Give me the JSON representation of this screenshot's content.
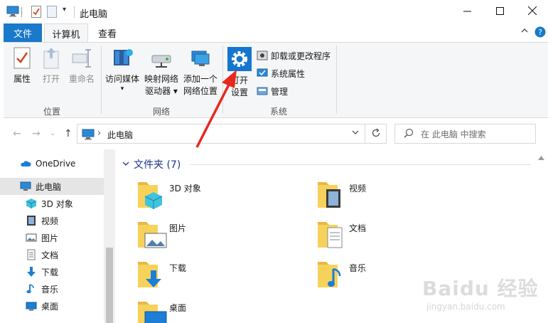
{
  "window": {
    "title": "此电脑",
    "minimize_icon": "minimize-icon",
    "maximize_icon": "maximize-icon",
    "close_icon": "close-icon"
  },
  "quick_access": {
    "icons": [
      "computer-icon",
      "properties-check-icon",
      "new-folder-icon"
    ],
    "dropdown": "▾"
  },
  "ribbon_tabs": {
    "file": "文件",
    "computer": "计算机",
    "view": "查看"
  },
  "ribbon": {
    "location": {
      "label": "位置",
      "properties": "属性",
      "open": "打开",
      "rename": "重命名"
    },
    "network": {
      "label": "网络",
      "access_media_1": "访问媒体",
      "access_media_2": "▾",
      "map_drive_1": "映射网络",
      "map_drive_2": "驱动器 ▾",
      "add_location_1": "添加一个",
      "add_location_2": "网络位置"
    },
    "system": {
      "label": "系统",
      "open_settings_1": "打开",
      "open_settings_2": "设置",
      "uninstall": "卸载或更改程序",
      "system_properties": "系统属性",
      "manage": "管理"
    }
  },
  "address_bar": {
    "path_separator": "›",
    "path": "此电脑",
    "search_placeholder": "在 此电脑 中搜索"
  },
  "sidebar": {
    "items": [
      {
        "label": "OneDrive",
        "icon": "cloud-icon"
      },
      {
        "label": "此电脑",
        "icon": "computer-icon",
        "selected": true
      },
      {
        "label": "3D 对象",
        "icon": "3d-cube-icon"
      },
      {
        "label": "视频",
        "icon": "video-icon"
      },
      {
        "label": "图片",
        "icon": "picture-icon"
      },
      {
        "label": "文档",
        "icon": "document-icon"
      },
      {
        "label": "下载",
        "icon": "download-icon"
      },
      {
        "label": "音乐",
        "icon": "music-icon"
      },
      {
        "label": "桌面",
        "icon": "desktop-icon"
      }
    ]
  },
  "main": {
    "section_title": "文件夹 (7)",
    "folders": [
      {
        "name": "3D 对象",
        "icon": "3d-folder-icon"
      },
      {
        "name": "视频",
        "icon": "video-folder-icon"
      },
      {
        "name": "图片",
        "icon": "picture-folder-icon"
      },
      {
        "name": "文档",
        "icon": "document-folder-icon"
      },
      {
        "name": "下载",
        "icon": "download-folder-icon"
      },
      {
        "name": "音乐",
        "icon": "music-folder-icon"
      },
      {
        "name": "桌面",
        "icon": "desktop-folder-icon"
      }
    ]
  },
  "watermark": {
    "logo": "Baidu 经验",
    "sub": "jingyan.baidu.com"
  },
  "colors": {
    "file_tab": "#1979ca",
    "section_title": "#1e3287",
    "annotation_arrow": "#e8281f",
    "folder_yellow": "#f7d25a"
  }
}
